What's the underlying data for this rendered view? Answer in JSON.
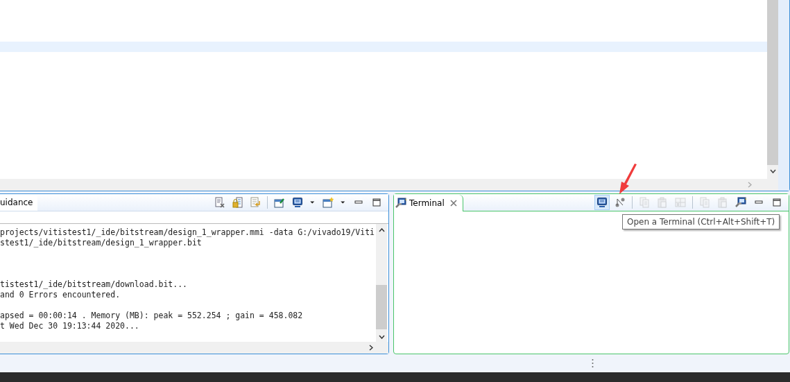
{
  "editor": {
    "highlighted_line": true
  },
  "console_panel": {
    "tab": {
      "label": "uidance",
      "selected": true
    },
    "toolbar": [
      {
        "kind": "clear",
        "disabled": false
      },
      {
        "kind": "lock",
        "disabled": false
      },
      {
        "kind": "wrap",
        "disabled": false
      },
      {
        "kind": "sep"
      },
      {
        "kind": "pin",
        "disabled": false
      },
      {
        "kind": "monitor",
        "disabled": false
      },
      {
        "kind": "caret",
        "disabled": false
      },
      {
        "kind": "newwin",
        "disabled": false
      },
      {
        "kind": "caret",
        "disabled": false
      },
      {
        "kind": "minimize",
        "disabled": false
      },
      {
        "kind": "maximize",
        "disabled": false
      }
    ],
    "lines": [
      {
        "kind": "text",
        "text": "projects/vitistest1/_ide/bitstream/design_1_wrapper.mmi -data G:/vivado19/Viti"
      },
      {
        "kind": "text",
        "text": "stest1/_ide/bitstream/design_1_wrapper.bit"
      },
      {
        "kind": "blank"
      },
      {
        "kind": "blank"
      },
      {
        "kind": "blank"
      },
      {
        "kind": "text",
        "text": "tistest1/_ide/bitstream/download.bit..."
      },
      {
        "kind": "text",
        "text": "and 0 Errors encountered."
      },
      {
        "kind": "blank"
      },
      {
        "kind": "text",
        "text": "apsed = 00:00:14 . Memory (MB): peak = 552.254 ; gain = 458.082"
      },
      {
        "kind": "text",
        "text": "t Wed Dec 30 19:13:44 2020..."
      }
    ]
  },
  "terminal_panel": {
    "tab": {
      "label": "Terminal",
      "selected": true
    },
    "toolbar": [
      {
        "kind": "monitor",
        "disabled": false,
        "hovered": true
      },
      {
        "kind": "connect",
        "disabled": false,
        "hovered": false
      },
      {
        "kind": "sep"
      },
      {
        "kind": "copy",
        "disabled": true,
        "hovered": false
      },
      {
        "kind": "paste",
        "disabled": true,
        "hovered": false
      },
      {
        "kind": "grid",
        "disabled": true,
        "hovered": false
      },
      {
        "kind": "sep"
      },
      {
        "kind": "copy",
        "disabled": true,
        "hovered": false
      },
      {
        "kind": "paste",
        "disabled": true,
        "hovered": false
      },
      {
        "kind": "terminal",
        "disabled": false,
        "hovered": false
      },
      {
        "kind": "minimize",
        "disabled": false,
        "hovered": false
      },
      {
        "kind": "maximize",
        "disabled": false,
        "hovered": false
      }
    ],
    "tooltip": "Open a Terminal (Ctrl+Alt+Shift+T)"
  }
}
